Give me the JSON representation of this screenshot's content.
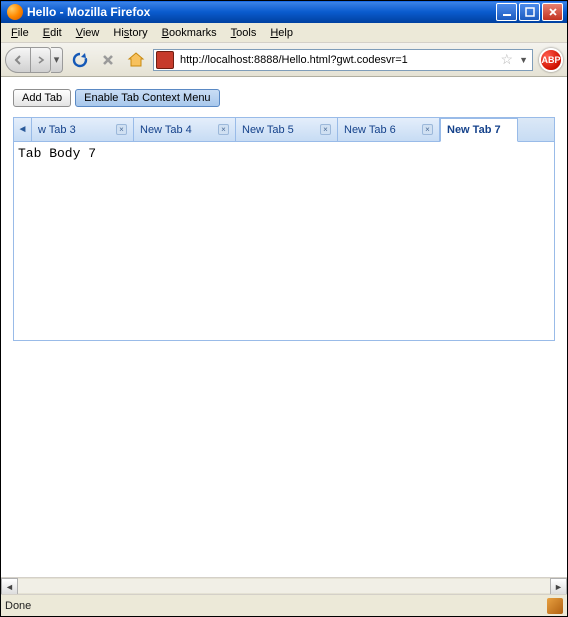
{
  "window": {
    "title": "Hello - Mozilla Firefox"
  },
  "menus": {
    "file": "File",
    "edit": "Edit",
    "view": "View",
    "history": "History",
    "bookmarks": "Bookmarks",
    "tools": "Tools",
    "help": "Help"
  },
  "url": "http://localhost:8888/Hello.html?gwt.codesvr=1",
  "abp": "ABP",
  "buttons": {
    "add_tab": "Add Tab",
    "enable_menu": "Enable Tab Context Menu"
  },
  "tabs": {
    "items": [
      {
        "label": "w Tab 3",
        "closable": true,
        "active": false
      },
      {
        "label": "New Tab 4",
        "closable": true,
        "active": false
      },
      {
        "label": "New Tab 5",
        "closable": true,
        "active": false
      },
      {
        "label": "New Tab 6",
        "closable": true,
        "active": false
      },
      {
        "label": "New Tab 7",
        "closable": false,
        "active": true
      }
    ]
  },
  "tab_body": "Tab Body 7",
  "status": "Done"
}
